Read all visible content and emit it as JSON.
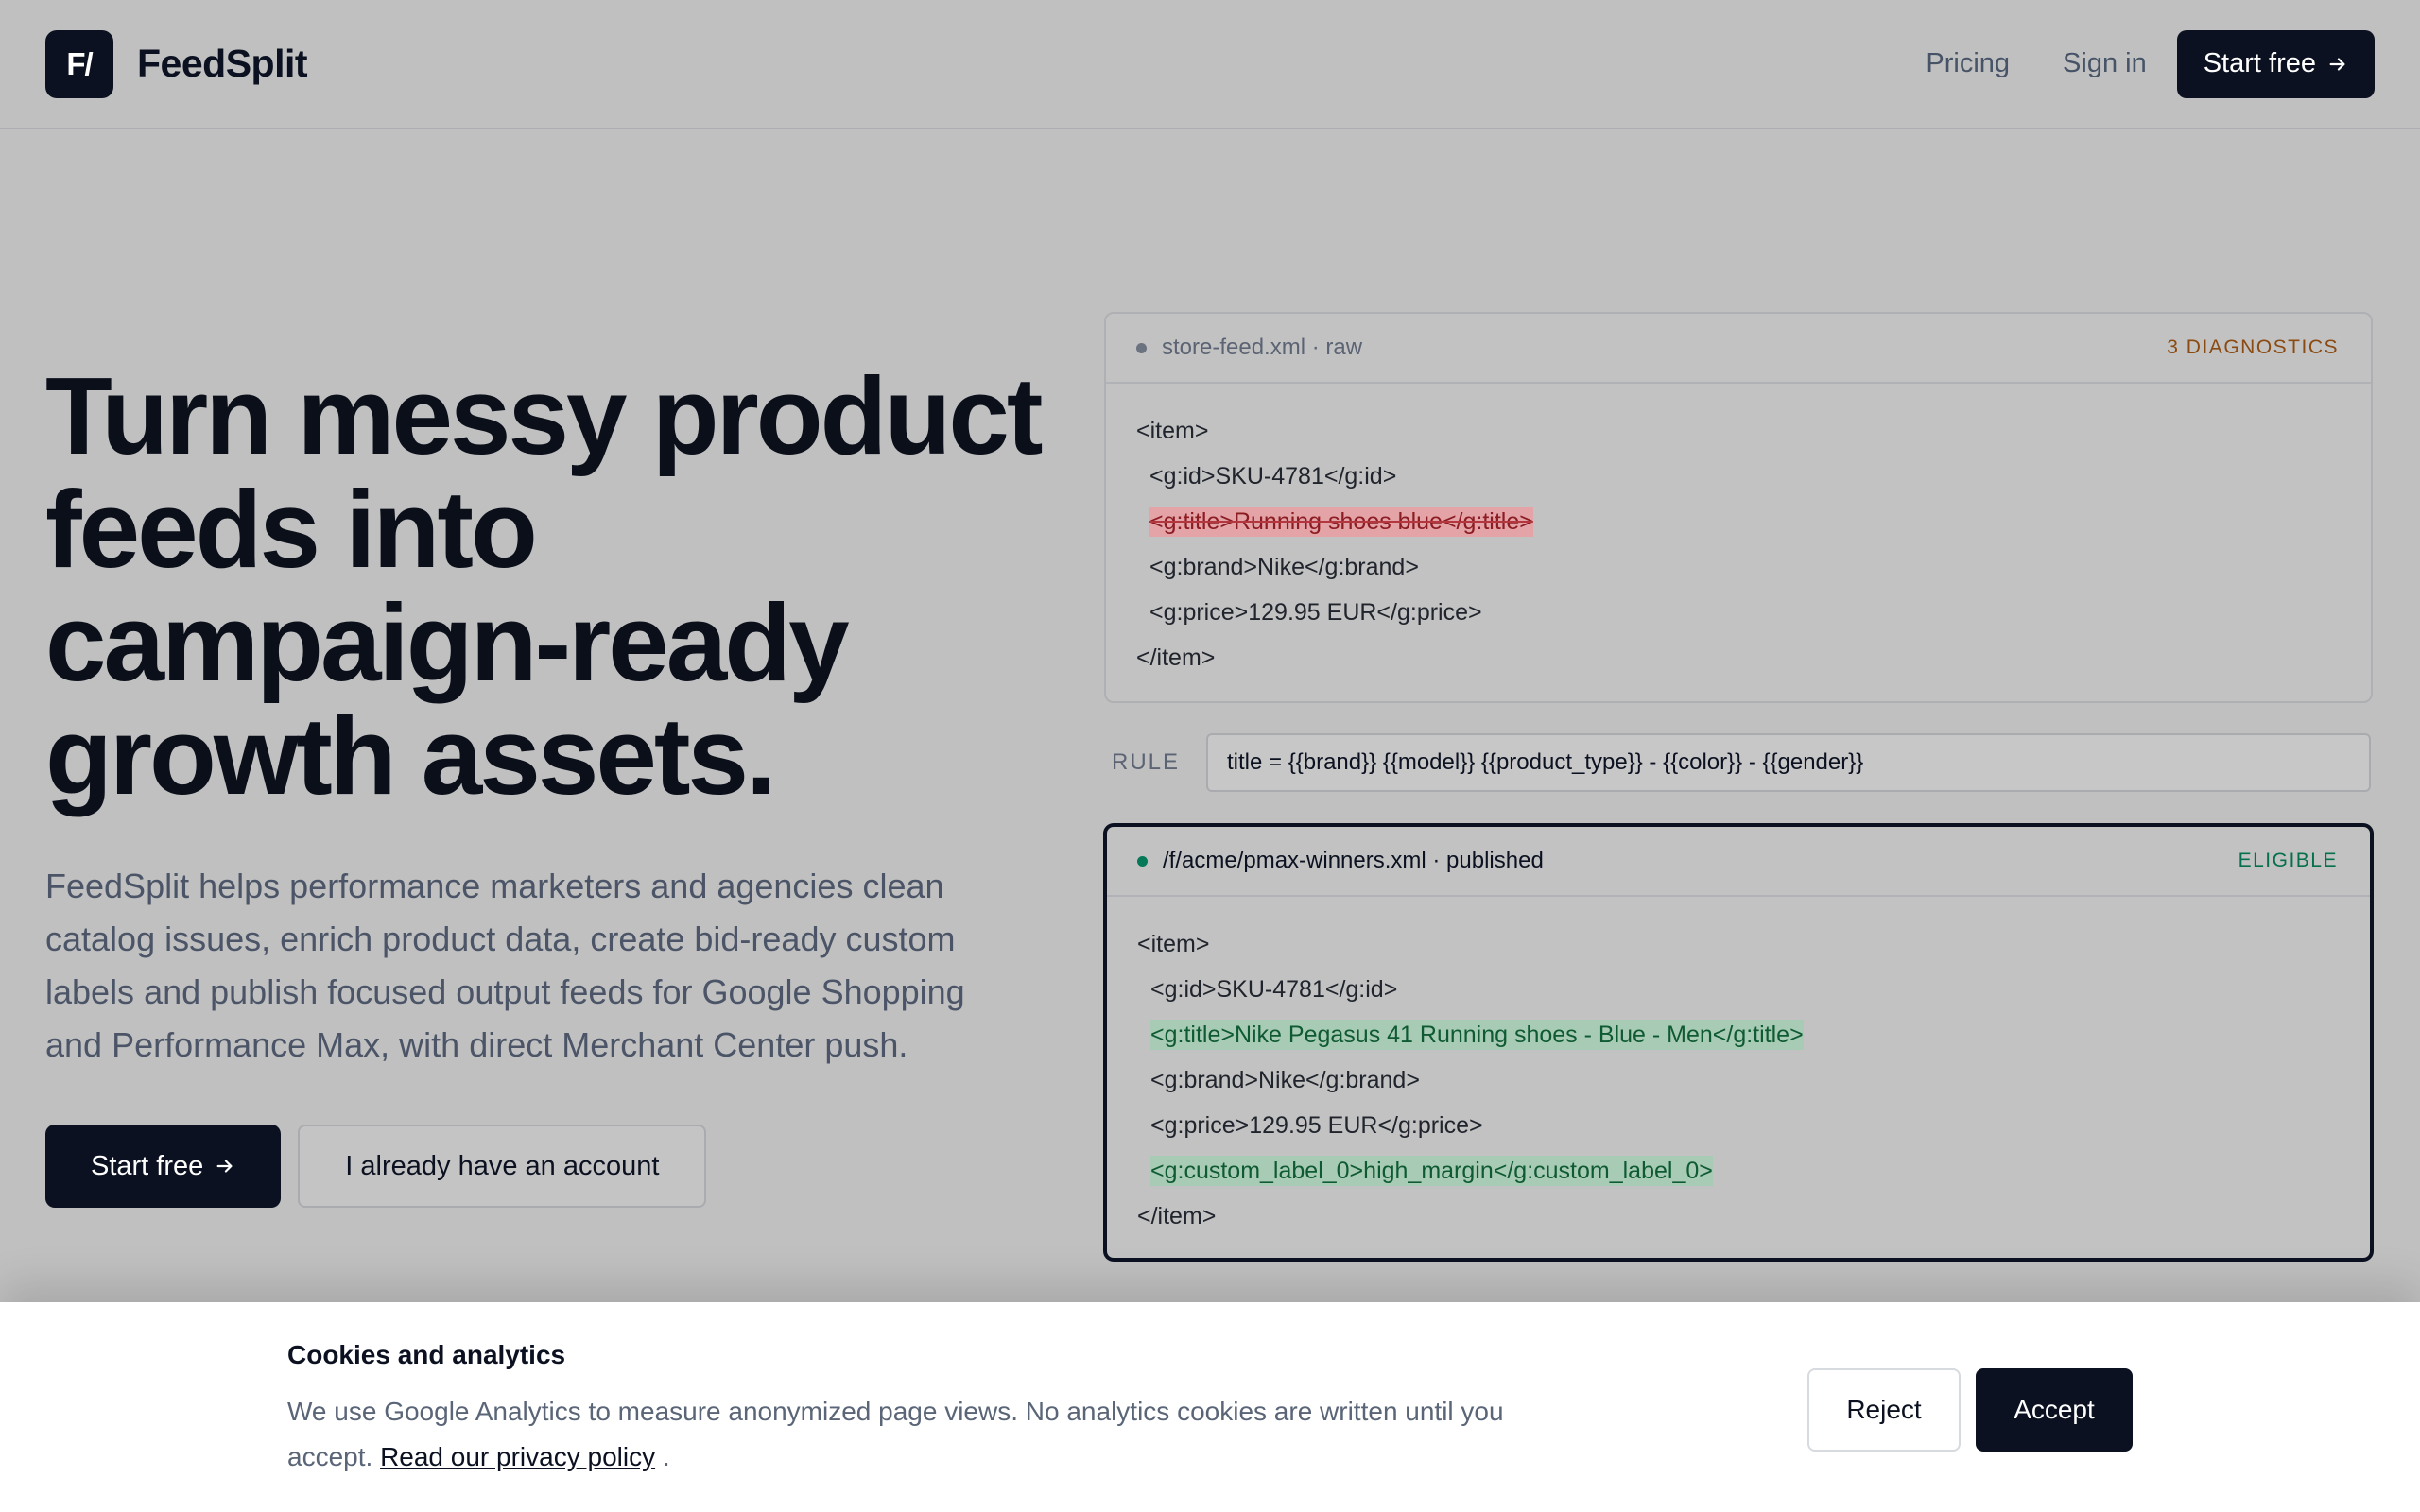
{
  "header": {
    "logo_text": "F/",
    "brand": "FeedSplit",
    "nav": {
      "pricing": "Pricing",
      "sign_in": "Sign in",
      "cta": "Start free"
    }
  },
  "hero": {
    "title": "Turn messy product feeds into campaign-ready growth assets.",
    "description": "FeedSplit helps performance marketers and agencies clean catalog issues, enrich product data, create bid-ready custom labels and publish focused output feeds for Google Shopping and Performance Max, with direct Merchant Center push.",
    "primary_cta": "Start free",
    "secondary_cta": "I already have an account"
  },
  "raw_feed": {
    "filename": "store-feed.xml · raw",
    "badge": "3 DIAGNOSTICS",
    "lines": [
      "<item>",
      "<g:id>SKU-4781</g:id>",
      "<g:title>Running shoes blue</g:title>",
      "<g:brand>Nike</g:brand>",
      "<g:price>129.95 EUR</g:price>",
      "</item>"
    ]
  },
  "rule": {
    "label": "RULE",
    "value": "title = {{brand}} {{model}} {{product_type}} - {{color}} - {{gender}}"
  },
  "output_feed": {
    "filename": "/f/acme/pmax-winners.xml · published",
    "badge": "ELIGIBLE",
    "lines": [
      "<item>",
      "<g:id>SKU-4781</g:id>",
      "<g:title>Nike Pegasus 41 Running shoes - Blue - Men</g:title>",
      "<g:brand>Nike</g:brand>",
      "<g:price>129.95 EUR</g:price>",
      "<g:custom_label_0>high_margin</g:custom_label_0>",
      "</item>"
    ]
  },
  "cookie": {
    "title": "Cookies and analytics",
    "text": "We use Google Analytics to measure anonymized page views. No analytics cookies are written until you accept.",
    "link": "Read our privacy policy",
    "reject": "Reject",
    "accept": "Accept"
  },
  "colors": {
    "primary": "#0b1120",
    "removed_highlight": "#e3a3a7",
    "added_highlight": "#a8cbb5",
    "warning": "#8a4a12",
    "success": "#04704d"
  }
}
